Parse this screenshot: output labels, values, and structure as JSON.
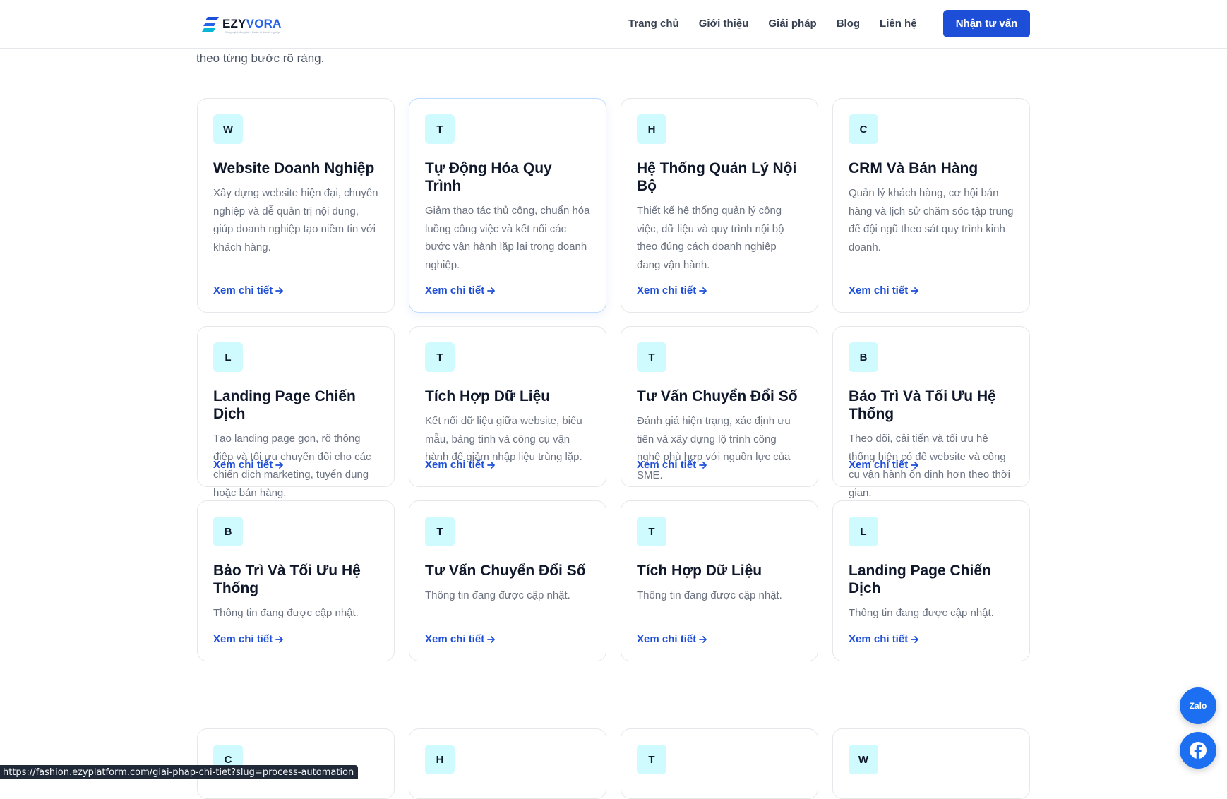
{
  "header": {
    "logo_part1": "EZY",
    "logo_part2": "VORA",
    "logo_tagline": "Công nghệ đồng bộ - Quản trị doanh nghiệp",
    "nav": [
      "Trang chủ",
      "Giới thiệu",
      "Giải pháp",
      "Blog",
      "Liên hệ"
    ],
    "cta": "Nhận tư vấn"
  },
  "intro_text": "theo từng bước rõ ràng.",
  "link_label": "Xem chi tiết",
  "cards": [
    {
      "letter": "W",
      "title": "Website Doanh Nghiệp",
      "desc": "Xây dựng website hiện đại, chuyên nghiệp và dễ quản trị nội dung, giúp doanh nghiệp tạo niềm tin với khách hàng."
    },
    {
      "letter": "T",
      "title": "Tự Động Hóa Quy Trình",
      "desc": "Giảm thao tác thủ công, chuẩn hóa luồng công việc và kết nối các bước vận hành lặp lại trong doanh nghiệp."
    },
    {
      "letter": "H",
      "title": "Hệ Thống Quản Lý Nội Bộ",
      "desc": "Thiết kế hệ thống quản lý công việc, dữ liệu và quy trình nội bộ theo đúng cách doanh nghiệp đang vận hành."
    },
    {
      "letter": "C",
      "title": "CRM Và Bán Hàng",
      "desc": "Quản lý khách hàng, cơ hội bán hàng và lịch sử chăm sóc tập trung để đội ngũ theo sát quy trình kinh doanh."
    },
    {
      "letter": "L",
      "title": "Landing Page Chiến Dịch",
      "desc": "Tạo landing page gọn, rõ thông điệp và tối ưu chuyển đổi cho các chiến dịch marketing, tuyển dụng hoặc bán hàng."
    },
    {
      "letter": "T",
      "title": "Tích Hợp Dữ Liệu",
      "desc": "Kết nối dữ liệu giữa website, biểu mẫu, bảng tính và công cụ vận hành để giảm nhập liệu trùng lặp."
    },
    {
      "letter": "T",
      "title": "Tư Vấn Chuyển Đổi Số",
      "desc": "Đánh giá hiện trạng, xác định ưu tiên và xây dựng lộ trình công nghệ phù hợp với nguồn lực của SME."
    },
    {
      "letter": "B",
      "title": "Bảo Trì Và Tối Ưu Hệ Thống",
      "desc": "Theo dõi, cải tiến và tối ưu hệ thống hiện có để website và công cụ vận hành ổn định hơn theo thời gian."
    },
    {
      "letter": "B",
      "title": "Bảo Trì Và Tối Ưu Hệ Thống",
      "desc": "Thông tin đang được cập nhật."
    },
    {
      "letter": "T",
      "title": "Tư Vấn Chuyển Đổi Số",
      "desc": "Thông tin đang được cập nhật."
    },
    {
      "letter": "T",
      "title": "Tích Hợp Dữ Liệu",
      "desc": "Thông tin đang được cập nhật."
    },
    {
      "letter": "L",
      "title": "Landing Page Chiến Dịch",
      "desc": "Thông tin đang được cập nhật."
    }
  ],
  "bottom_row_letters": [
    "C",
    "H",
    "T",
    "W"
  ],
  "floating": {
    "zalo": "Zalo"
  },
  "status_url": "https://fashion.ezyplatform.com/giai-phap-chi-tiet?slug=process-automation",
  "colors": {
    "accent": "#1d4ed8",
    "badge_bg": "#cffafe"
  }
}
